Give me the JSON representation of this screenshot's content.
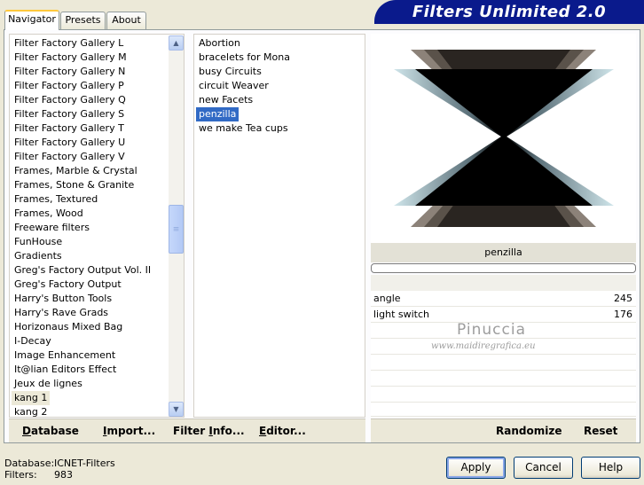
{
  "tabs": [
    {
      "label": "Navigator",
      "active": true
    },
    {
      "label": "Presets",
      "active": false
    },
    {
      "label": "About",
      "active": false
    }
  ],
  "header_title": "Filters Unlimited 2.0",
  "categories": [
    "Filter Factory Gallery L",
    "Filter Factory Gallery M",
    "Filter Factory Gallery N",
    "Filter Factory Gallery P",
    "Filter Factory Gallery Q",
    "Filter Factory Gallery S",
    "Filter Factory Gallery T",
    "Filter Factory Gallery U",
    "Filter Factory Gallery V",
    "Frames, Marble & Crystal",
    "Frames, Stone & Granite",
    "Frames, Textured",
    "Frames, Wood",
    "Freeware filters",
    "FunHouse",
    "Gradients",
    "Greg's Factory Output Vol. II",
    "Greg's Factory Output",
    "Harry's Button Tools",
    "Harry's Rave Grads",
    "Horizonaus Mixed Bag",
    "I-Decay",
    "Image Enhancement",
    "It@lian Editors Effect",
    "Jeux de lignes",
    "kang 1",
    "kang 2"
  ],
  "selected_category": "kang 1",
  "filters": [
    "Abortion",
    "bracelets for Mona",
    "busy Circuits",
    "circuit Weaver",
    "new Facets",
    "penzilla",
    "we make Tea cups"
  ],
  "selected_filter": "penzilla",
  "preview_filter_name": "penzilla",
  "params": [
    {
      "label": "angle",
      "value": "245"
    },
    {
      "label": "light switch",
      "value": "176"
    }
  ],
  "toolbar": {
    "database": {
      "accel": "D",
      "rest": "atabase"
    },
    "import": {
      "accel": "I",
      "rest": "mport..."
    },
    "filter_info": {
      "pre": "Filter ",
      "accel": "I",
      "rest": "nfo..."
    },
    "editor": {
      "accel": "E",
      "rest": "ditor..."
    },
    "randomize": "Randomize",
    "reset": "Reset"
  },
  "watermark": {
    "name": "Pinuccia",
    "site": "www.maidiregrafica.eu"
  },
  "status": {
    "database_label": "Database:",
    "database_value": "ICNET-Filters",
    "filters_label": "Filters:",
    "filters_value": "983"
  },
  "buttons": {
    "apply": "Apply",
    "cancel": "Cancel",
    "help": "Help"
  },
  "colors": {
    "header_bg": "#0a1a8c",
    "selection": "#316ac5",
    "tab_active_accent": "#ffc83c"
  }
}
